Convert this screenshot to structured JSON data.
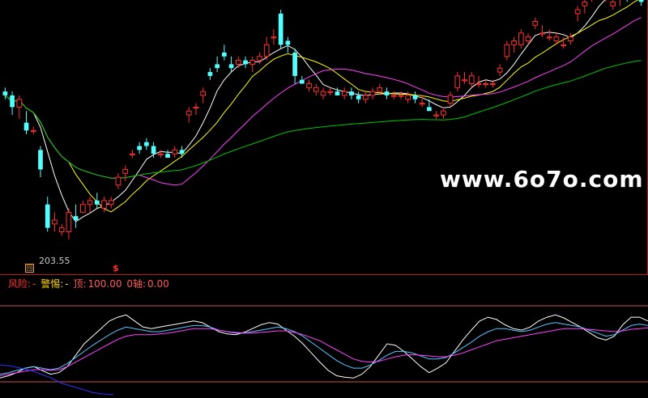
{
  "main": {
    "min_price_label": "203.55",
    "min_marker": "回",
    "signal_marker": "$",
    "watermark": "www.6o7o.com"
  },
  "indicator": {
    "risk_label": "风险:",
    "risk_value": "-",
    "warn_label": "警惕:",
    "warn_value": "-",
    "top_label": "顶:",
    "top_value": "100.00",
    "axis_label": "0轴:",
    "axis_value": "0.00"
  },
  "chart_data": [
    {
      "type": "candlestick",
      "title": "",
      "colors": {
        "up": "#ff3030",
        "down": "#54ffff",
        "ma1": "#ffffff",
        "ma2": "#ffff00",
        "ma3": "#ff40ff",
        "ma4": "#00c800"
      },
      "ylim": [
        200,
        265
      ],
      "candles": [
        [
          244,
          245,
          242,
          243
        ],
        [
          243,
          244,
          238,
          240
        ],
        [
          240,
          243,
          237,
          242
        ],
        [
          236,
          239,
          233,
          234
        ],
        [
          234,
          235,
          233,
          234
        ],
        [
          229,
          230,
          222,
          224
        ],
        [
          215,
          217,
          208,
          209
        ],
        [
          210,
          213,
          208,
          211
        ],
        [
          208,
          210,
          207,
          209
        ],
        [
          208,
          214,
          206,
          213
        ],
        [
          212,
          215,
          209,
          211
        ],
        [
          213,
          216,
          213,
          215
        ],
        [
          215,
          217,
          213,
          216
        ],
        [
          216,
          218,
          214,
          215
        ],
        [
          214,
          217,
          213,
          216
        ],
        [
          215,
          217,
          214,
          216
        ],
        [
          220,
          223,
          219,
          222
        ],
        [
          223,
          225,
          221,
          224
        ],
        [
          228,
          229,
          227,
          228
        ],
        [
          230,
          231,
          228,
          229
        ],
        [
          231,
          232,
          229,
          230
        ],
        [
          230,
          231,
          227,
          228
        ],
        [
          228,
          229,
          227,
          228
        ],
        [
          228,
          229,
          227,
          227
        ],
        [
          228,
          230,
          227,
          229
        ],
        [
          229,
          230,
          227,
          228
        ],
        [
          238,
          240,
          236,
          239
        ],
        [
          240,
          241,
          238,
          240
        ],
        [
          243,
          245,
          241,
          244
        ],
        [
          249,
          250,
          247,
          248
        ],
        [
          251,
          253,
          249,
          250
        ],
        [
          254,
          256,
          252,
          253
        ],
        [
          251,
          253,
          249,
          250
        ],
        [
          251,
          253,
          250,
          252
        ],
        [
          252,
          253,
          250,
          251
        ],
        [
          251,
          253,
          249,
          252
        ],
        [
          252,
          254,
          251,
          253
        ],
        [
          253,
          258,
          252,
          256
        ],
        [
          258,
          260,
          256,
          258
        ],
        [
          264,
          265,
          255,
          256
        ],
        [
          257,
          258,
          254,
          256
        ],
        [
          254,
          255,
          246,
          248
        ],
        [
          247,
          248,
          246,
          246
        ],
        [
          245,
          247,
          244,
          246
        ],
        [
          244,
          246,
          243,
          245
        ],
        [
          243,
          245,
          242,
          244
        ],
        [
          244,
          245,
          243,
          244
        ],
        [
          244,
          245,
          243,
          243
        ],
        [
          243,
          245,
          242,
          244
        ],
        [
          244,
          245,
          242,
          243
        ],
        [
          243,
          244,
          241,
          242
        ],
        [
          242,
          244,
          241,
          243
        ],
        [
          243,
          245,
          242,
          244
        ],
        [
          244,
          246,
          243,
          245
        ],
        [
          244,
          245,
          242,
          243
        ],
        [
          243,
          244,
          242,
          243
        ],
        [
          243,
          244,
          242,
          243
        ],
        [
          242,
          244,
          241,
          243
        ],
        [
          243,
          244,
          241,
          242
        ],
        [
          241,
          243,
          240,
          241
        ],
        [
          240,
          242,
          239,
          239
        ],
        [
          238,
          239,
          237,
          238
        ],
        [
          238,
          240,
          237,
          239
        ],
        [
          241,
          244,
          240,
          243
        ],
        [
          245,
          249,
          244,
          248
        ],
        [
          247,
          249,
          246,
          247
        ],
        [
          246,
          249,
          245,
          248
        ],
        [
          246,
          248,
          245,
          246
        ],
        [
          246,
          247,
          245,
          246
        ],
        [
          246,
          247,
          245,
          246
        ],
        [
          249,
          251,
          248,
          250
        ],
        [
          253,
          257,
          252,
          256
        ],
        [
          256,
          258,
          254,
          257
        ],
        [
          256,
          260,
          255,
          259
        ],
        [
          257,
          259,
          256,
          258
        ],
        [
          261,
          263,
          260,
          262
        ],
        [
          259,
          261,
          258,
          259
        ],
        [
          258,
          260,
          257,
          258
        ],
        [
          257,
          259,
          256,
          258
        ],
        [
          256,
          258,
          255,
          256
        ],
        [
          257,
          259,
          256,
          258
        ],
        [
          264,
          266,
          262,
          265
        ],
        [
          266,
          268,
          264,
          267
        ],
        [
          269,
          271,
          267,
          270
        ],
        [
          270,
          271,
          268,
          269
        ],
        [
          268,
          270,
          267,
          268
        ],
        [
          266,
          268,
          265,
          267
        ],
        [
          268,
          270,
          266,
          269
        ],
        [
          269,
          271,
          267,
          268
        ],
        [
          270,
          272,
          268,
          269
        ],
        [
          271,
          272,
          266,
          267
        ]
      ]
    },
    {
      "type": "line",
      "title": "",
      "ylim": [
        0,
        100
      ],
      "series": [
        {
          "values": [
            5,
            8,
            12,
            18,
            20,
            15,
            10,
            12,
            20,
            35,
            50,
            60,
            70,
            80,
            85,
            88,
            80,
            72,
            70,
            72,
            74,
            76,
            78,
            80,
            78,
            72,
            66,
            63,
            62,
            65,
            70,
            75,
            78,
            76,
            68,
            60,
            50,
            38,
            26,
            15,
            8,
            6,
            5,
            10,
            20,
            35,
            50,
            48,
            40,
            30,
            20,
            12,
            18,
            25,
            40,
            55,
            68,
            80,
            85,
            82,
            75,
            70,
            68,
            72,
            80,
            85,
            88,
            84,
            78,
            72,
            65,
            58,
            55,
            60,
            75,
            85,
            85,
            80
          ]
        },
        {
          "values": [
            10,
            12,
            15,
            18,
            20,
            18,
            16,
            18,
            24,
            32,
            40,
            48,
            55,
            62,
            68,
            72,
            70,
            68,
            66,
            66,
            68,
            70,
            72,
            74,
            74,
            72,
            68,
            66,
            64,
            64,
            66,
            68,
            70,
            72,
            70,
            66,
            60,
            52,
            44,
            36,
            28,
            22,
            18,
            18,
            22,
            28,
            35,
            40,
            40,
            38,
            34,
            30,
            30,
            32,
            38,
            45,
            52,
            60,
            66,
            70,
            70,
            68,
            66,
            68,
            72,
            76,
            78,
            76,
            74,
            72,
            68,
            64,
            60,
            62,
            68,
            74,
            76,
            74
          ]
        },
        {
          "values": [
            8,
            10,
            12,
            14,
            16,
            16,
            15,
            16,
            20,
            26,
            32,
            38,
            44,
            50,
            56,
            60,
            62,
            62,
            62,
            63,
            64,
            66,
            68,
            70,
            70,
            70,
            68,
            66,
            65,
            64,
            64,
            65,
            66,
            67,
            67,
            65,
            62,
            58,
            54,
            48,
            42,
            36,
            30,
            27,
            26,
            27,
            30,
            33,
            35,
            36,
            35,
            34,
            33,
            33,
            35,
            38,
            42,
            46,
            50,
            54,
            56,
            58,
            60,
            62,
            64,
            66,
            68,
            70,
            70,
            70,
            69,
            68,
            67,
            66,
            67,
            69,
            70,
            71
          ]
        },
        {
          "values": [
            22,
            21,
            18,
            15,
            10,
            5,
            -2,
            -6,
            -10,
            -14,
            -16,
            -17
          ]
        }
      ],
      "reference_lines": [
        100,
        0
      ]
    }
  ]
}
